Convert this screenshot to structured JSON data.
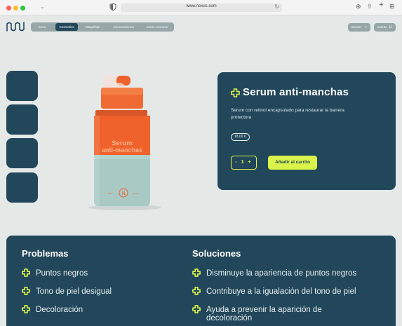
{
  "browser": {
    "url": "www.nexus.com"
  },
  "nav": {
    "items": [
      {
        "label": "Inicio"
      },
      {
        "label": "Cosmetics"
      },
      {
        "label": "Maquillaje"
      },
      {
        "label": "Asesoramiento"
      },
      {
        "label": "Sobre nosotros"
      }
    ],
    "search_label": "Buscar",
    "cart_label": "Carrito"
  },
  "product": {
    "title": "Serum anti-manchas",
    "description": "Serum con retinol encapsulado para restaurar la barrera protectora",
    "price": "18,00 €",
    "qty_label": "- 1 +",
    "add_to_cart": "Añadir al carrito",
    "bottle_label_line1": "Serum",
    "bottle_label_line2": "anti-manchas"
  },
  "info": {
    "problems_title": "Problemas",
    "problems": [
      "Puntos negros",
      "Tono de piel desigual",
      "Decoloración"
    ],
    "solutions_title": "Soluciones",
    "solutions": [
      "Disminuye la apariencia de puntos negros",
      "Contribuye a la igualación del tono de piel",
      "Ayuda a prevenir la aparición de decoloración"
    ]
  },
  "colors": {
    "primary": "#22475a",
    "accent": "#d9f34a",
    "background": "#e4e9e8",
    "bottle_orange": "#f0622c",
    "bottle_mint": "#a9c9c4"
  }
}
